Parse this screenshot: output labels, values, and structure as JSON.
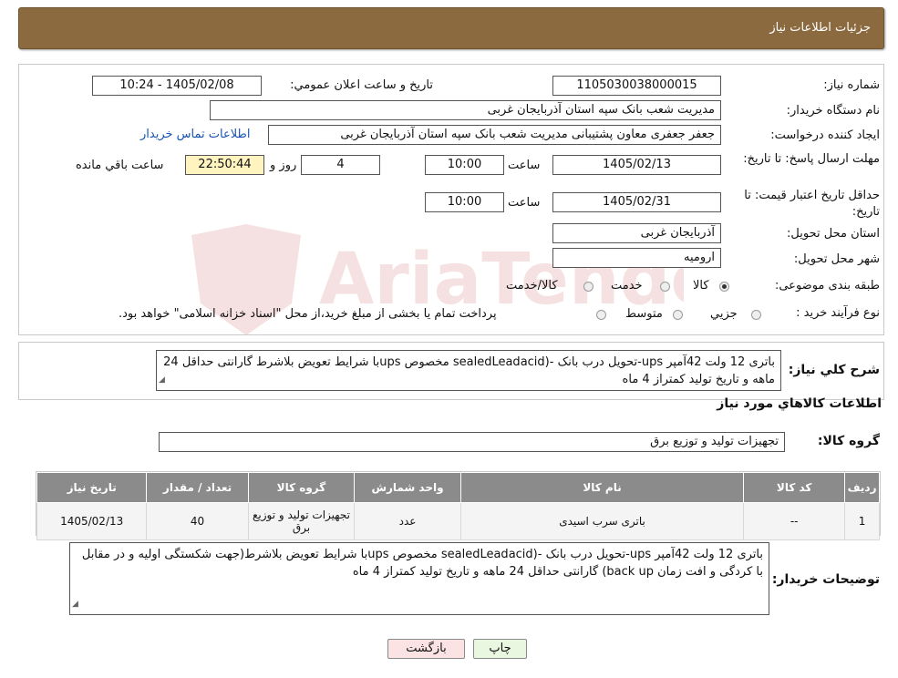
{
  "header": {
    "title": "جزئیات اطلاعات نیاز"
  },
  "form": {
    "need_number_label": "شماره نیاز:",
    "need_number": "1105030038000015",
    "announce_label": "تاریخ و ساعت اعلان عمومي:",
    "announce_value": "1405/02/08 - 10:24",
    "buyer_org_label": "نام دستگاه خريدار:",
    "buyer_org": "مديريت شعب بانک سپه استان آذربايجان غربی",
    "requester_label": "ايجاد کننده درخواست:",
    "requester": "جعفر جعفری معاون پشتيبانی مديريت شعب بانک سپه استان آذربايجان غربی",
    "contact_link": "اطلاعات تماس خريدار",
    "deadline_label": "مهلت ارسال پاسخ: تا تاريخ:",
    "deadline_date": "1405/02/13",
    "time_label": "ساعت",
    "deadline_time": "10:00",
    "days_value": "4",
    "days_label": "روز و",
    "remaining_time": "22:50:44",
    "remaining_label": "ساعت باقي مانده",
    "validity_label": "حداقل تاريخ اعتبار قيمت: تا تاريخ:",
    "validity_date": "1405/02/31",
    "validity_time": "10:00",
    "province_label": "استان محل تحويل:",
    "province": "آذربايجان غربی",
    "city_label": "شهر محل تحويل:",
    "city": "اروميه",
    "category_label": "طبقه بندی موضوعی:",
    "category_options": [
      "کالا",
      "خدمت",
      "کالا/خدمت"
    ],
    "category_selected": "کالا",
    "purchase_type_label": "نوع فرآيند خريد :",
    "purchase_options": [
      "جزيي",
      "متوسط"
    ],
    "purchase_note": "پرداخت تمام يا بخشی از مبلغ خريد،از محل \"اسناد خزانه اسلامی\" خواهد بود."
  },
  "summary": {
    "label": "شرح کلي نياز:",
    "text": "باتری 12 ولت 42آمپر ups-تحويل درب بانک -(sealedLeadacid مخصوص upsبا شرايط تعويض بلاشرط گارانتی حداقل 24 ماهه و تاريخ توليد کمتراز 4 ماه"
  },
  "goods": {
    "section_title": "اطلاعات کالاهاي مورد نياز",
    "group_label": "گروه کالا:",
    "group_value": "تجهيزات توليد و توزيع برق",
    "columns": [
      "رديف",
      "کد کالا",
      "نام کالا",
      "واحد شمارش",
      "گروه کالا",
      "تعداد / مقدار",
      "تاريخ نياز"
    ],
    "rows": [
      [
        "1",
        "--",
        "باتری سرب اسيدی",
        "عدد",
        "تجهيزات توليد و توزيع برق",
        "40",
        "1405/02/13"
      ]
    ]
  },
  "buyer_notes": {
    "label": "توضيحات خريدار:",
    "text": "باتری 12 ولت 42آمپر ups-تحويل درب بانک -(sealedLeadacid مخصوص upsبا شرايط تعويض بلاشرط(جهت شکستگی اوليه و در مقابل با کردگی و افت زمان back up) گارانتی حداقل 24 ماهه و تاريخ توليد کمتراز 4 ماه"
  },
  "buttons": {
    "print": "چاپ",
    "back": "بازگشت"
  },
  "watermark": {
    "text": "AriaTender.neT"
  },
  "colors": {
    "header_bg": "#8b6a3f",
    "table_header_bg": "#8b8b8b",
    "print_bg": "#eaf7e0",
    "back_bg": "#fbe3e3",
    "timer_bg": "#fff4c0"
  }
}
